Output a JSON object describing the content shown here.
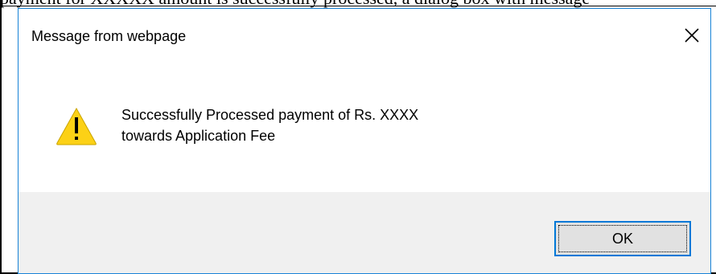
{
  "background_text": "payment for XXXXX amount is successfully processed, a dialog box with message",
  "dialog": {
    "title": "Message from webpage",
    "close_icon": "close-icon",
    "icon": "warning-icon",
    "message_line1": "Successfully Processed payment of Rs. XXXX",
    "message_line2": "towards Application Fee",
    "ok_label": "OK"
  },
  "colors": {
    "accent_border": "#1883d7",
    "button_focus": "#0078d7",
    "footer_bg": "#f0f0f0",
    "warning_fill": "#fcd116"
  }
}
